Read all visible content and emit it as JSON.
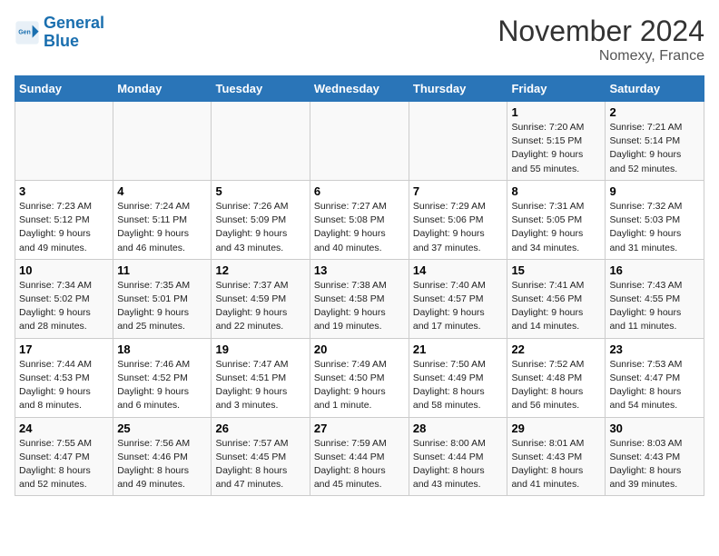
{
  "logo": {
    "line1": "General",
    "line2": "Blue"
  },
  "title": "November 2024",
  "location": "Nomexy, France",
  "headers": [
    "Sunday",
    "Monday",
    "Tuesday",
    "Wednesday",
    "Thursday",
    "Friday",
    "Saturday"
  ],
  "weeks": [
    [
      {
        "day": "",
        "info": ""
      },
      {
        "day": "",
        "info": ""
      },
      {
        "day": "",
        "info": ""
      },
      {
        "day": "",
        "info": ""
      },
      {
        "day": "",
        "info": ""
      },
      {
        "day": "1",
        "info": "Sunrise: 7:20 AM\nSunset: 5:15 PM\nDaylight: 9 hours\nand 55 minutes."
      },
      {
        "day": "2",
        "info": "Sunrise: 7:21 AM\nSunset: 5:14 PM\nDaylight: 9 hours\nand 52 minutes."
      }
    ],
    [
      {
        "day": "3",
        "info": "Sunrise: 7:23 AM\nSunset: 5:12 PM\nDaylight: 9 hours\nand 49 minutes."
      },
      {
        "day": "4",
        "info": "Sunrise: 7:24 AM\nSunset: 5:11 PM\nDaylight: 9 hours\nand 46 minutes."
      },
      {
        "day": "5",
        "info": "Sunrise: 7:26 AM\nSunset: 5:09 PM\nDaylight: 9 hours\nand 43 minutes."
      },
      {
        "day": "6",
        "info": "Sunrise: 7:27 AM\nSunset: 5:08 PM\nDaylight: 9 hours\nand 40 minutes."
      },
      {
        "day": "7",
        "info": "Sunrise: 7:29 AM\nSunset: 5:06 PM\nDaylight: 9 hours\nand 37 minutes."
      },
      {
        "day": "8",
        "info": "Sunrise: 7:31 AM\nSunset: 5:05 PM\nDaylight: 9 hours\nand 34 minutes."
      },
      {
        "day": "9",
        "info": "Sunrise: 7:32 AM\nSunset: 5:03 PM\nDaylight: 9 hours\nand 31 minutes."
      }
    ],
    [
      {
        "day": "10",
        "info": "Sunrise: 7:34 AM\nSunset: 5:02 PM\nDaylight: 9 hours\nand 28 minutes."
      },
      {
        "day": "11",
        "info": "Sunrise: 7:35 AM\nSunset: 5:01 PM\nDaylight: 9 hours\nand 25 minutes."
      },
      {
        "day": "12",
        "info": "Sunrise: 7:37 AM\nSunset: 4:59 PM\nDaylight: 9 hours\nand 22 minutes."
      },
      {
        "day": "13",
        "info": "Sunrise: 7:38 AM\nSunset: 4:58 PM\nDaylight: 9 hours\nand 19 minutes."
      },
      {
        "day": "14",
        "info": "Sunrise: 7:40 AM\nSunset: 4:57 PM\nDaylight: 9 hours\nand 17 minutes."
      },
      {
        "day": "15",
        "info": "Sunrise: 7:41 AM\nSunset: 4:56 PM\nDaylight: 9 hours\nand 14 minutes."
      },
      {
        "day": "16",
        "info": "Sunrise: 7:43 AM\nSunset: 4:55 PM\nDaylight: 9 hours\nand 11 minutes."
      }
    ],
    [
      {
        "day": "17",
        "info": "Sunrise: 7:44 AM\nSunset: 4:53 PM\nDaylight: 9 hours\nand 8 minutes."
      },
      {
        "day": "18",
        "info": "Sunrise: 7:46 AM\nSunset: 4:52 PM\nDaylight: 9 hours\nand 6 minutes."
      },
      {
        "day": "19",
        "info": "Sunrise: 7:47 AM\nSunset: 4:51 PM\nDaylight: 9 hours\nand 3 minutes."
      },
      {
        "day": "20",
        "info": "Sunrise: 7:49 AM\nSunset: 4:50 PM\nDaylight: 9 hours\nand 1 minute."
      },
      {
        "day": "21",
        "info": "Sunrise: 7:50 AM\nSunset: 4:49 PM\nDaylight: 8 hours\nand 58 minutes."
      },
      {
        "day": "22",
        "info": "Sunrise: 7:52 AM\nSunset: 4:48 PM\nDaylight: 8 hours\nand 56 minutes."
      },
      {
        "day": "23",
        "info": "Sunrise: 7:53 AM\nSunset: 4:47 PM\nDaylight: 8 hours\nand 54 minutes."
      }
    ],
    [
      {
        "day": "24",
        "info": "Sunrise: 7:55 AM\nSunset: 4:47 PM\nDaylight: 8 hours\nand 52 minutes."
      },
      {
        "day": "25",
        "info": "Sunrise: 7:56 AM\nSunset: 4:46 PM\nDaylight: 8 hours\nand 49 minutes."
      },
      {
        "day": "26",
        "info": "Sunrise: 7:57 AM\nSunset: 4:45 PM\nDaylight: 8 hours\nand 47 minutes."
      },
      {
        "day": "27",
        "info": "Sunrise: 7:59 AM\nSunset: 4:44 PM\nDaylight: 8 hours\nand 45 minutes."
      },
      {
        "day": "28",
        "info": "Sunrise: 8:00 AM\nSunset: 4:44 PM\nDaylight: 8 hours\nand 43 minutes."
      },
      {
        "day": "29",
        "info": "Sunrise: 8:01 AM\nSunset: 4:43 PM\nDaylight: 8 hours\nand 41 minutes."
      },
      {
        "day": "30",
        "info": "Sunrise: 8:03 AM\nSunset: 4:43 PM\nDaylight: 8 hours\nand 39 minutes."
      }
    ]
  ]
}
